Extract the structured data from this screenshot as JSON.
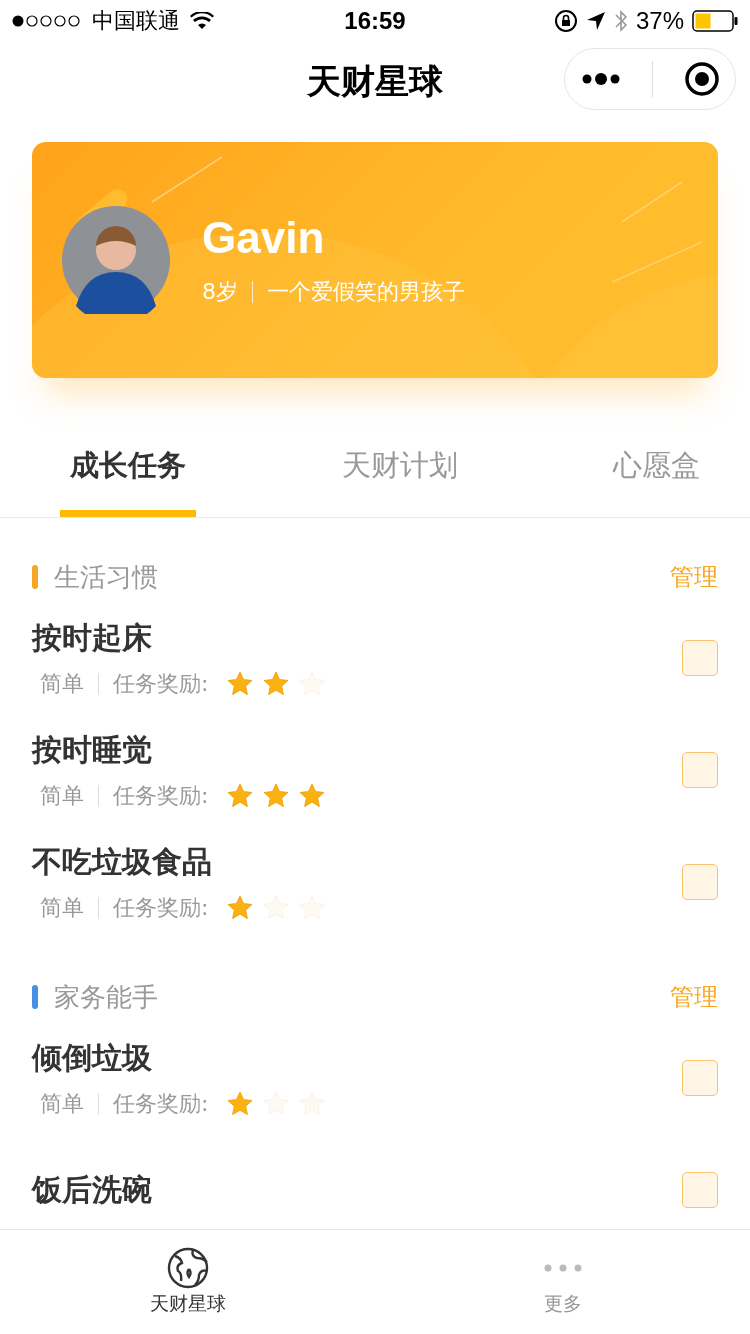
{
  "status_bar": {
    "carrier": "中国联通",
    "time": "16:59",
    "battery_text": "37%"
  },
  "nav": {
    "title": "天财星球"
  },
  "profile": {
    "name": "Gavin",
    "age": "8岁",
    "motto": "一个爱假笑的男孩子"
  },
  "tabs": [
    {
      "label": "成长任务",
      "selected": true
    },
    {
      "label": "天财计划",
      "selected": false
    },
    {
      "label": "心愿盒",
      "selected": false
    }
  ],
  "sections": [
    {
      "title": "生活习惯",
      "color": "#f5a623",
      "action": "管理",
      "tasks": [
        {
          "title": "按时起床",
          "difficulty": "简单",
          "reward_label": "任务奖励:",
          "stars": 2,
          "checked": false
        },
        {
          "title": "按时睡觉",
          "difficulty": "简单",
          "reward_label": "任务奖励:",
          "stars": 3,
          "checked": false
        },
        {
          "title": "不吃垃圾食品",
          "difficulty": "简单",
          "reward_label": "任务奖励:",
          "stars": 1,
          "checked": false
        }
      ]
    },
    {
      "title": "家务能手",
      "color": "#4a90e2",
      "action": "管理",
      "tasks": [
        {
          "title": "倾倒垃圾",
          "difficulty": "简单",
          "reward_label": "任务奖励:",
          "stars": 1,
          "checked": false
        },
        {
          "title": "饭后洗碗",
          "checked": false
        }
      ]
    }
  ],
  "tab_bar": [
    {
      "label": "天财星球",
      "kind": "globe",
      "selected": true
    },
    {
      "label": "更多",
      "kind": "more",
      "selected": false
    }
  ]
}
